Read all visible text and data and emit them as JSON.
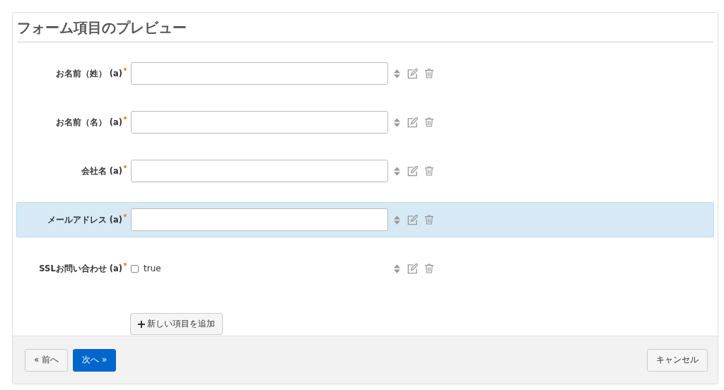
{
  "title": "フォーム項目のプレビュー",
  "fields": [
    {
      "kind": "text",
      "label": "お名前（姓） (a)",
      "required": true,
      "selected": false
    },
    {
      "kind": "text",
      "label": "お名前（名） (a)",
      "required": true,
      "selected": false
    },
    {
      "kind": "text",
      "label": "会社名 (a)",
      "required": true,
      "selected": false
    },
    {
      "kind": "text",
      "label": "メールアドレス (a)",
      "required": true,
      "selected": true
    },
    {
      "kind": "checkbox",
      "label": "SSLお問い合わせ (a)",
      "required": true,
      "selected": false,
      "option": "true",
      "checked": false
    }
  ],
  "add_button": "新しい項目を追加",
  "footer": {
    "prev": "« 前へ",
    "next": "次へ »",
    "cancel": "キャンセル"
  }
}
